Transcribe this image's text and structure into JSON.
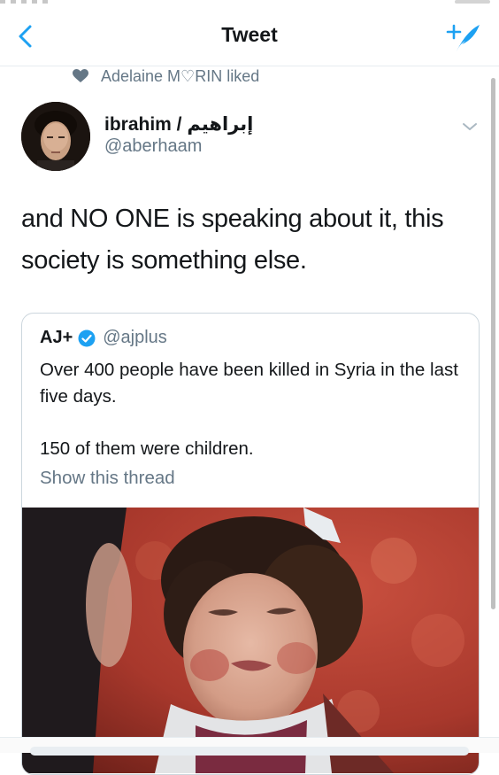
{
  "navbar": {
    "title": "Tweet",
    "back_icon": "chevron-left-icon",
    "compose_icon": "compose-tweet-icon",
    "accent_color": "#1da1f2"
  },
  "social_context": {
    "icon": "heart-icon",
    "text": "Adelaine M♡RIN liked"
  },
  "tweet": {
    "display_name": "ibrahim / إبراهيم",
    "handle": "@aberhaam",
    "text": "and NO ONE is speaking about it, this society is something else."
  },
  "quoted_tweet": {
    "name": "AJ+",
    "verified_icon": "verified-badge-icon",
    "handle": "@ajplus",
    "paragraphs": [
      "Over 400 people have been killed in Syria in the last five days.",
      "150 of them were children."
    ],
    "show_thread": "Show this thread",
    "media_alt": "photo-of-injured-crying-child"
  },
  "colors": {
    "text_primary": "#14171a",
    "text_secondary": "#657786",
    "border": "#ccd6dd"
  }
}
